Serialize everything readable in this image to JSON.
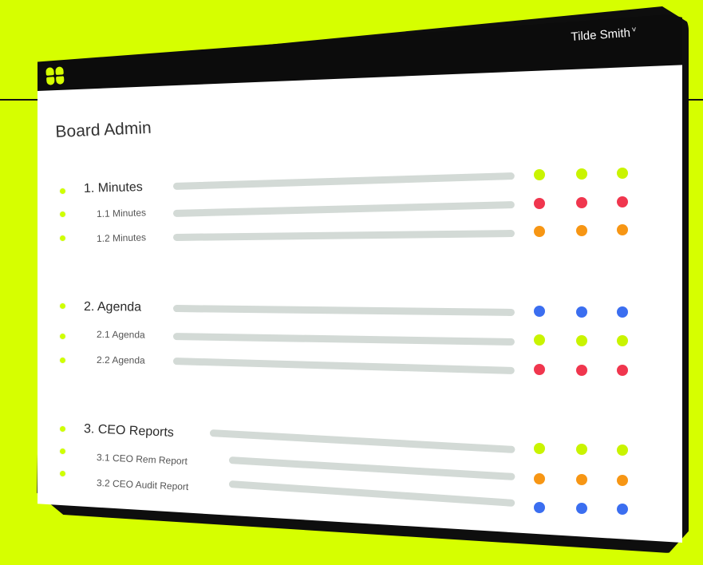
{
  "header": {
    "user_name": "Tilde Smith",
    "user_suffix": "˅"
  },
  "page_title": "Board Admin",
  "colors": {
    "background": "#d6ff00",
    "green": "#c9f400",
    "red": "#f0364e",
    "orange": "#f79614",
    "blue": "#3b6ef0",
    "bar": "#d3dad6"
  },
  "sections": [
    {
      "title": "1. Minutes",
      "status": [
        "green",
        "green",
        "green"
      ],
      "items": [
        {
          "label": "1.1 Minutes",
          "status": [
            "red",
            "red",
            "red"
          ]
        },
        {
          "label": "1.2 Minutes",
          "status": [
            "orange",
            "orange",
            "orange"
          ]
        }
      ]
    },
    {
      "title": "2. Agenda",
      "status": [
        "blue",
        "blue",
        "blue"
      ],
      "items": [
        {
          "label": "2.1 Agenda",
          "status": [
            "green",
            "green",
            "green"
          ]
        },
        {
          "label": "2.2 Agenda",
          "status": [
            "red",
            "red",
            "red"
          ]
        }
      ]
    },
    {
      "title": "3. CEO Reports",
      "status": [
        "green",
        "green",
        "green"
      ],
      "items": [
        {
          "label": "3.1 CEO Rem Report",
          "status": [
            "orange",
            "orange",
            "orange"
          ]
        },
        {
          "label": "3.2 CEO Audit Report",
          "status": [
            "blue",
            "blue",
            "blue"
          ]
        }
      ]
    }
  ]
}
